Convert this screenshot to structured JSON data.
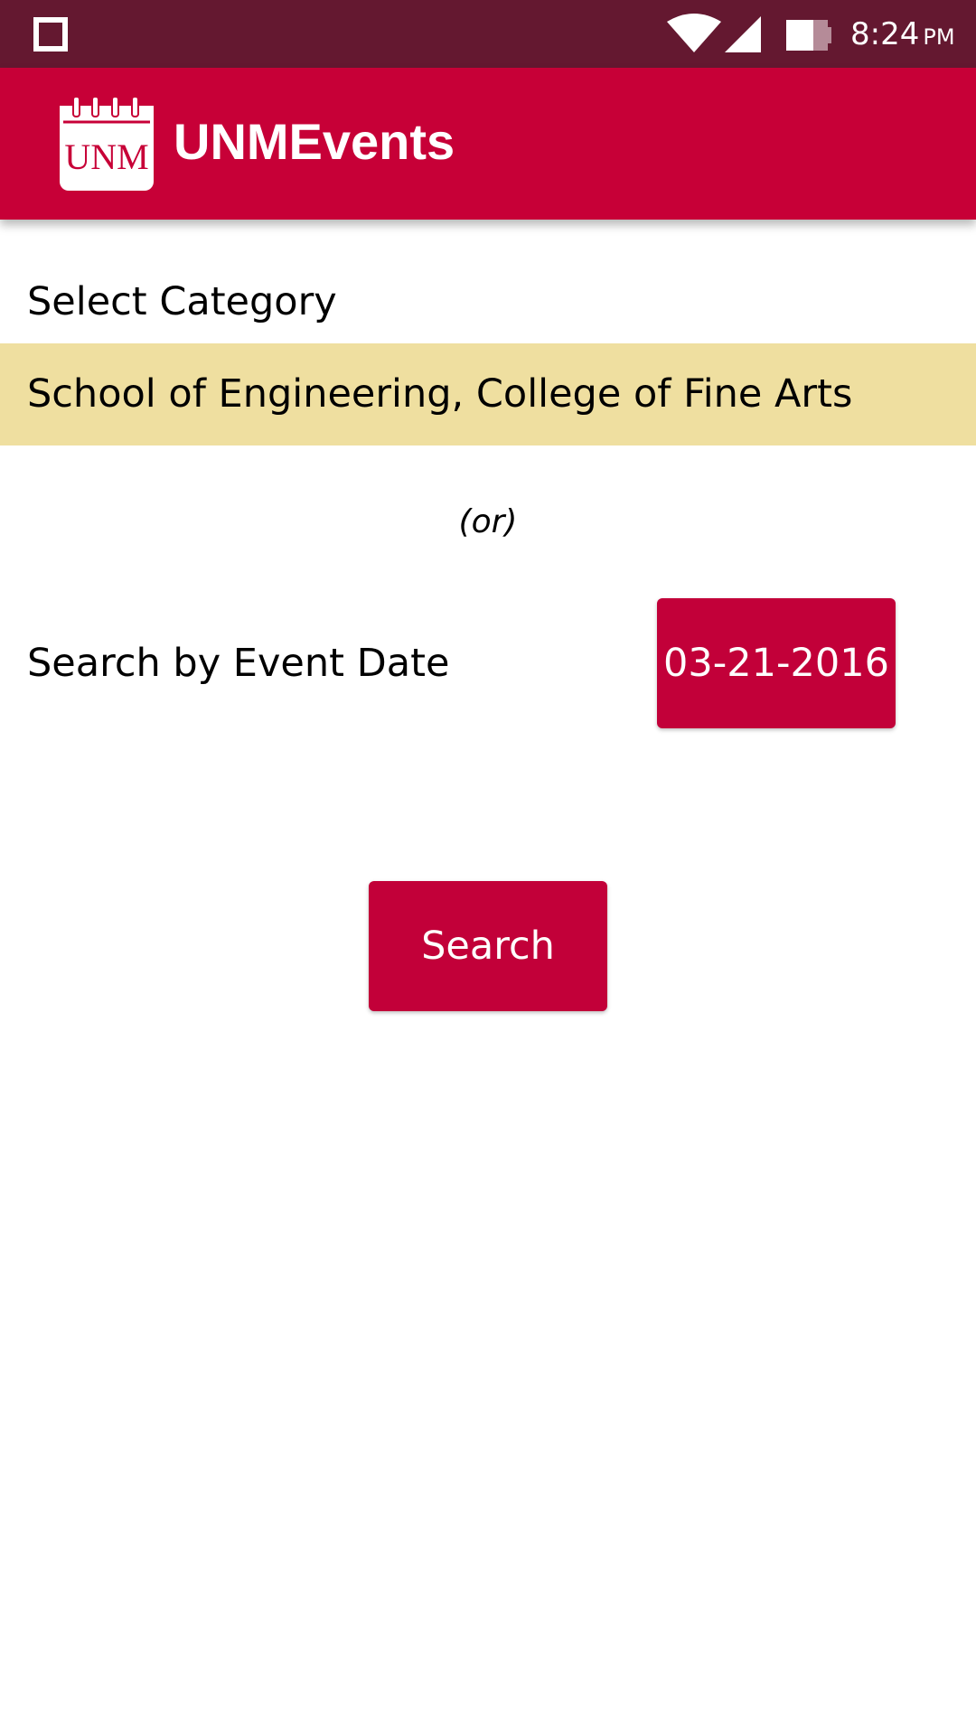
{
  "status_bar": {
    "time": "8:24",
    "ampm": "PM",
    "left_icon": "square-notification-icon",
    "wifi_icon": "wifi-icon",
    "signal_icon": "cell-signal-icon",
    "battery_icon": "battery-icon"
  },
  "app_bar": {
    "title": "UNMEvents",
    "logo_icon": "unm-calendar-logo-icon",
    "logo_text": "UNM"
  },
  "form": {
    "category_label": "Select Category",
    "category_value": "School of Engineering, College of Fine Arts",
    "or_text": "(or)",
    "date_label": "Search by Event Date",
    "date_value": "03-21-2016",
    "search_label": "Search"
  },
  "colors": {
    "status_bar": "#641830",
    "app_bar": "#c70037",
    "button": "#c20039",
    "category_highlight": "#efdfa0"
  }
}
